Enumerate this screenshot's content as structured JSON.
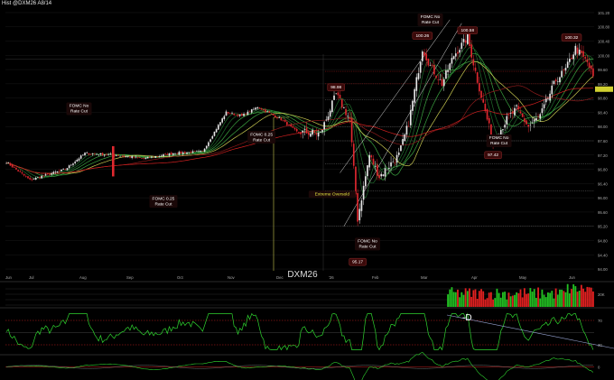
{
  "header": {
    "title": "Hist",
    "symbol": "@DXM26 A8/14"
  },
  "watermark": "DXM26",
  "colors": {
    "background": "#000000",
    "up": "#e6e6e6",
    "down": "#e0282f",
    "ma_green_dark": "#1f6b2c",
    "ma_green": "#3ba340",
    "ma_yellow": "#c8c850",
    "ma_red": "#d02020",
    "osc": "#2fd32f",
    "vol_up": "#22c022",
    "vol_down": "#e02020",
    "annot_fill": "#3a0a0a",
    "annot_text": "#ffffff",
    "price_tag": "#d0d030"
  },
  "chart_data": {
    "type": "candlestick",
    "x_labels": [
      "Jun",
      "Jul",
      "Aug",
      "Sep",
      "Oct",
      "Nov",
      "Dec",
      "'26",
      "Feb",
      "Mar",
      "Apr",
      "May",
      "Jun"
    ],
    "y_ticks": [
      94.0,
      94.4,
      94.8,
      95.2,
      95.6,
      96.0,
      96.4,
      96.8,
      97.2,
      97.6,
      98.0,
      98.4,
      98.8,
      99.2,
      99.6,
      100.0,
      100.4,
      100.8,
      101.2
    ],
    "y_range": [
      93.9,
      101.3
    ],
    "annotations": [
      {
        "text": "FOMC No Rate Cut",
        "kind": "callout",
        "bar": 37,
        "y": 98.5
      },
      {
        "text": "FOMC 0.25 Rate Cut",
        "kind": "callout",
        "bar": 80,
        "y": 95.9
      },
      {
        "text": "FOMC 0.25 Rate Cut",
        "kind": "callout",
        "bar": 130,
        "y": 97.7
      },
      {
        "text": "98.98",
        "kind": "price",
        "bar": 168,
        "y": 99.1
      },
      {
        "text": "Extreme Oversold",
        "kind": "callout",
        "bar": 166,
        "y": 96.1
      },
      {
        "text": "FOMC No Rate Cut",
        "kind": "callout",
        "bar": 184,
        "y": 94.7
      },
      {
        "text": "95.17",
        "kind": "price",
        "bar": 179,
        "y": 94.2
      },
      {
        "text": "FOMC No Rate Cut",
        "kind": "callout",
        "bar": 216,
        "y": 101.0
      },
      {
        "text": "100.26",
        "kind": "price",
        "bar": 212,
        "y": 100.55
      },
      {
        "text": "100.58",
        "kind": "price",
        "bar": 235,
        "y": 100.7
      },
      {
        "text": "FOMC No Rate Cut",
        "kind": "callout",
        "bar": 251,
        "y": 97.6
      },
      {
        "text": "97.42",
        "kind": "price",
        "bar": 248,
        "y": 97.2
      },
      {
        "text": "100.32",
        "kind": "price",
        "bar": 288,
        "y": 100.5
      }
    ],
    "panels": [
      "price",
      "volume",
      "oscillator",
      "momentum"
    ],
    "osc_label": "-D"
  }
}
